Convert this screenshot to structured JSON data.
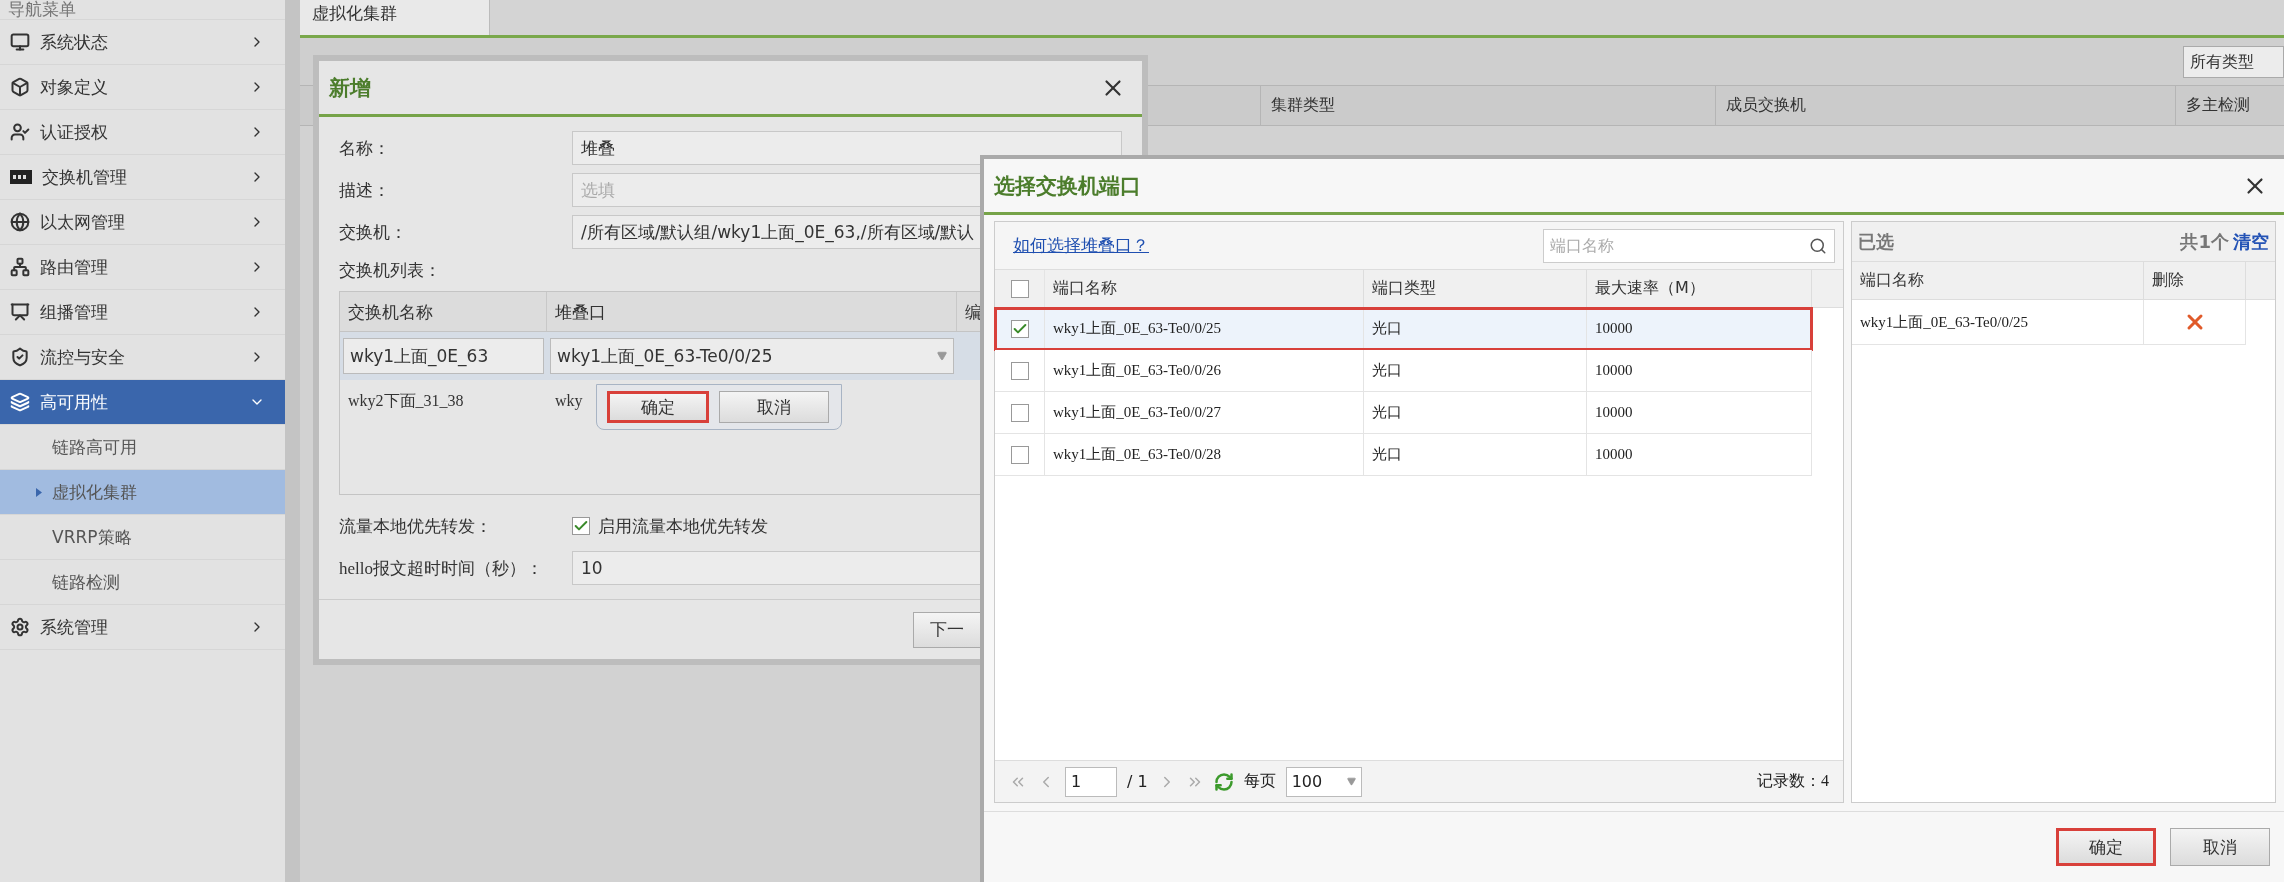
{
  "sidebar": {
    "title": "导航菜单",
    "items": [
      {
        "label": "系统状态",
        "expanded": false
      },
      {
        "label": "对象定义",
        "expanded": false
      },
      {
        "label": "认证授权",
        "expanded": false
      },
      {
        "label": "交换机管理",
        "expanded": false
      },
      {
        "label": "以太网管理",
        "expanded": false
      },
      {
        "label": "路由管理",
        "expanded": false
      },
      {
        "label": "组播管理",
        "expanded": false
      },
      {
        "label": "流控与安全",
        "expanded": false
      },
      {
        "label": "高可用性",
        "expanded": true,
        "children": [
          {
            "label": "链路高可用",
            "selected": false
          },
          {
            "label": "虚拟化集群",
            "selected": true
          },
          {
            "label": "VRRP策略",
            "selected": false
          },
          {
            "label": "链路检测",
            "selected": false
          }
        ]
      },
      {
        "label": "系统管理",
        "expanded": false
      }
    ]
  },
  "main": {
    "tabs": [
      {
        "label": "虚拟化集群",
        "selected": true
      }
    ],
    "type_filter": "所有类型",
    "columns": [
      "集群类型",
      "成员交换机",
      "多主检测"
    ]
  },
  "add_dialog": {
    "title": "新增",
    "fields": [
      {
        "label": "名称：",
        "value": "堆叠"
      },
      {
        "label": "描述：",
        "placeholder": "选填"
      },
      {
        "label": "交换机：",
        "value": "/所有区域/默认组/wky1上面_0E_63,/所有区域/默认"
      }
    ],
    "switch_list": {
      "label": "交换机列表：",
      "columns": [
        "交换机名称",
        "堆叠口",
        "编"
      ],
      "rows": [
        {
          "name": "wky1上面_0E_63",
          "port": "wky1上面_0E_63-Te0/0/25",
          "editing": true
        },
        {
          "name": "wky2下面_31_38",
          "port": "wky",
          "editing": false
        }
      ]
    },
    "popup_buttons": [
      {
        "label": "确定",
        "highlighted": true
      },
      {
        "label": "取消",
        "highlighted": false
      }
    ],
    "local_forward": {
      "label": "流量本地优先转发：",
      "option": "启用流量本地优先转发",
      "checked": true
    },
    "hello_timeout": {
      "label": "hello报文超时时间（秒）：",
      "value": "10"
    },
    "next_button": "下一"
  },
  "port_dialog": {
    "title": "选择交换机端口",
    "help_link": "如何选择堆叠口？",
    "search": {
      "placeholder": "端口名称"
    },
    "all_checked": false,
    "columns": [
      "端口名称",
      "端口类型",
      "最大速率（M）"
    ],
    "rows": [
      {
        "name": "wky1上面_0E_63-Te0/0/25",
        "type": "光口",
        "speed": "10000",
        "checked": true,
        "highlighted": true
      },
      {
        "name": "wky1上面_0E_63-Te0/0/26",
        "type": "光口",
        "speed": "10000",
        "checked": false,
        "highlighted": false
      },
      {
        "name": "wky1上面_0E_63-Te0/0/27",
        "type": "光口",
        "speed": "10000",
        "checked": false,
        "highlighted": false
      },
      {
        "name": "wky1上面_0E_63-Te0/0/28",
        "type": "光口",
        "speed": "10000",
        "checked": false,
        "highlighted": false
      }
    ],
    "pager": {
      "page": "1",
      "pages": "/ 1",
      "per_page_label": "每页",
      "per_page": "100",
      "records": "记录数：4"
    },
    "selected_panel": {
      "title": "已选",
      "count": "共1个",
      "clear": "清空",
      "columns": [
        "端口名称",
        "删除"
      ],
      "rows": [
        {
          "name": "wky1上面_0E_63-Te0/0/25"
        }
      ]
    },
    "buttons": [
      {
        "label": "确定",
        "highlighted": true
      },
      {
        "label": "取消",
        "highlighted": false
      }
    ]
  }
}
